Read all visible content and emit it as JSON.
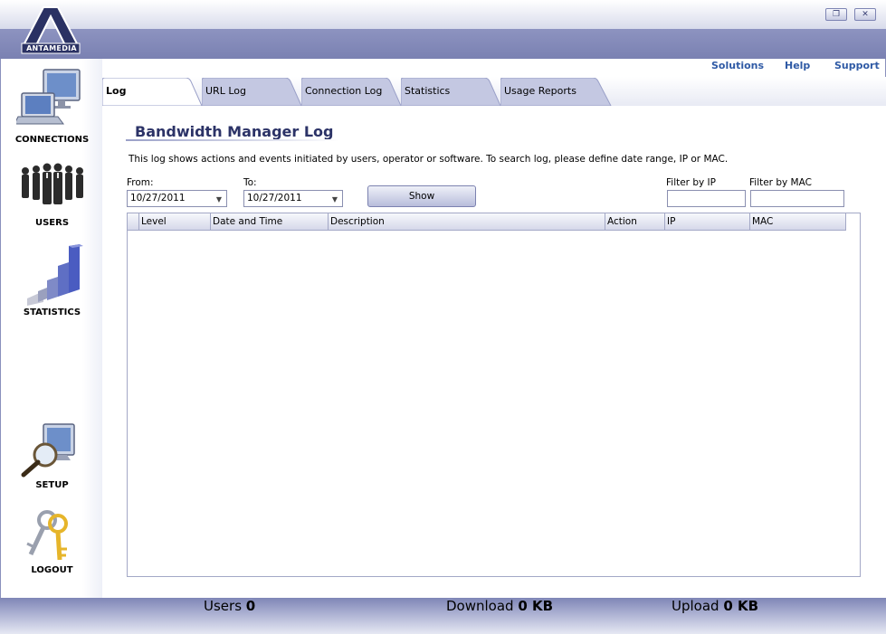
{
  "app": {
    "logo_text": "ANTAMEDIA",
    "window": {
      "restore_symbol": "❐",
      "close_symbol": "✕"
    }
  },
  "top_links": [
    {
      "label": "Solutions"
    },
    {
      "label": "Help"
    },
    {
      "label": "Support"
    }
  ],
  "sidebar": {
    "items": [
      {
        "label": "CONNECTIONS",
        "icon": "computer-icon"
      },
      {
        "label": "USERS",
        "icon": "people-icon"
      },
      {
        "label": "STATISTICS",
        "icon": "bar-chart-icon"
      },
      {
        "label": "SETUP",
        "icon": "magnifier-icon"
      },
      {
        "label": "LOGOUT",
        "icon": "keys-icon"
      }
    ]
  },
  "tabs": [
    {
      "label": "Log",
      "active": true
    },
    {
      "label": "URL Log",
      "active": false
    },
    {
      "label": "Connection Log",
      "active": false
    },
    {
      "label": "Statistics",
      "active": false
    },
    {
      "label": "Usage Reports",
      "active": false
    }
  ],
  "content": {
    "title": "Bandwidth Manager Log",
    "description": "This log shows actions and events initiated by users, operator or software. To search log, please define date range, IP or MAC.",
    "from_label": "From:",
    "from_value": "10/27/2011",
    "to_label": "To:",
    "to_value": "10/27/2011",
    "show_label": "Show",
    "filter_ip_label": "Filter by IP",
    "filter_ip_value": "",
    "filter_mac_label": "Filter by MAC",
    "filter_mac_value": ""
  },
  "grid": {
    "columns": [
      "Level",
      "Date and Time",
      "Description",
      "Action",
      "IP",
      "MAC"
    ],
    "rows": []
  },
  "footer": {
    "users_label": "Users",
    "users_value": "0",
    "download_label": "Download",
    "download_value": "0 KB",
    "upload_label": "Upload",
    "upload_value": "0 KB"
  },
  "colors": {
    "header_band": "#7c83b3",
    "link": "#2f5aa5",
    "title": "#2c3367"
  }
}
